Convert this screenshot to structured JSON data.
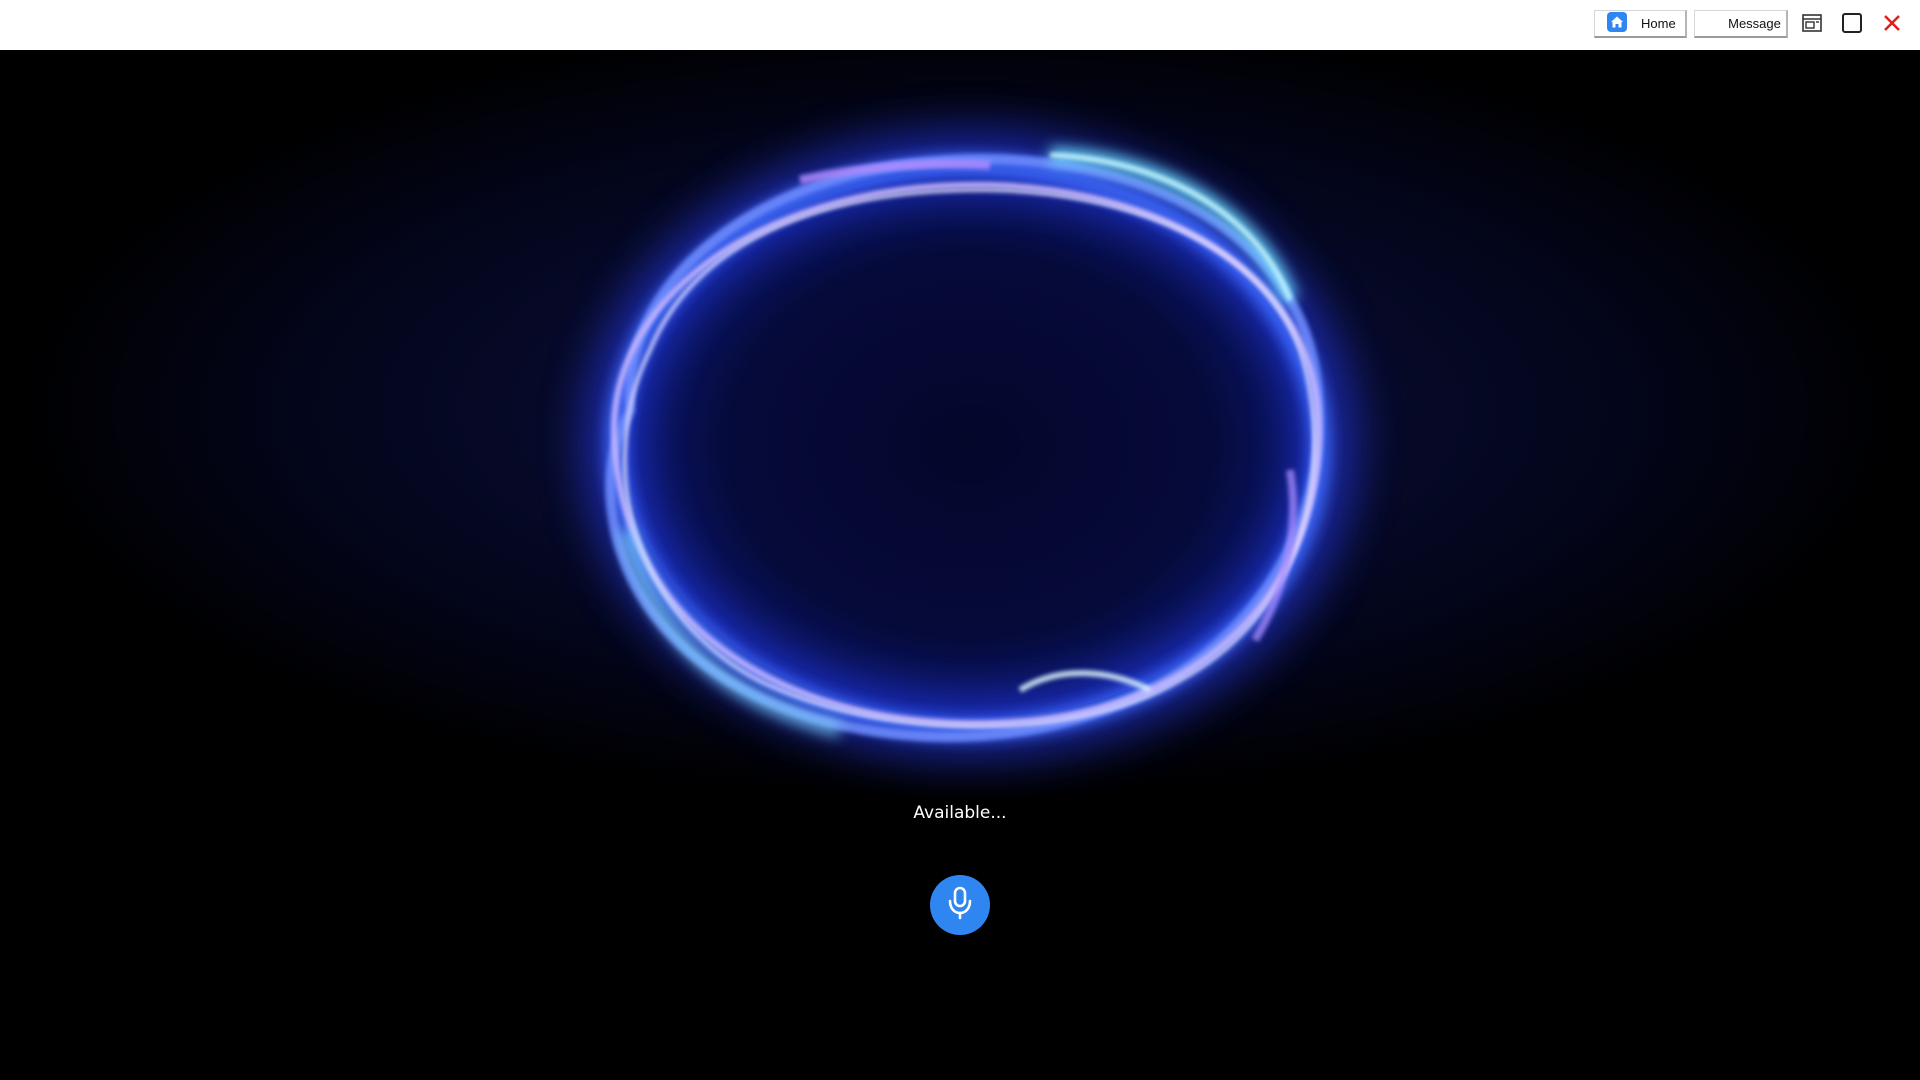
{
  "window": {
    "home_label": "Home",
    "message_label": "Message",
    "controls": [
      "restore-icon",
      "maximize-icon",
      "close-icon"
    ]
  },
  "assistant": {
    "status_text": "Available...",
    "mic_icon": "microphone-icon",
    "accent_color": "#2f86f0",
    "ring_colors": [
      "#3d6bff",
      "#a98cff",
      "#5fd6ff"
    ]
  }
}
